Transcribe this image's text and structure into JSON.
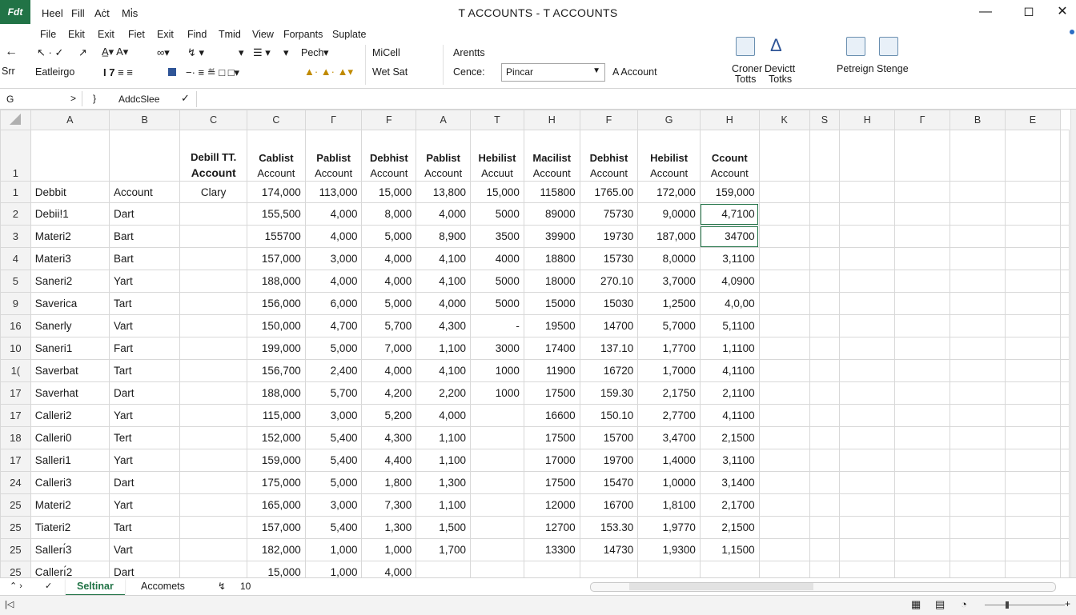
{
  "app": {
    "title": "T ACCOUNTS - T ACCOUNTS",
    "logo": "Fdt",
    "quick_access": [
      "Heel",
      "Fill",
      "Aċt",
      "Mi̇s"
    ]
  },
  "menu": [
    "File",
    "Ekit",
    "Exit",
    "Fiet",
    "Exit",
    "Find",
    "Tmid",
    "View",
    "Forpants",
    "Suplate"
  ],
  "ribbon": {
    "back_label": "Srr",
    "font_label": "Eatleirgo",
    "pech": "Pech",
    "micell": "MiCell",
    "wet_set": "Wet Sat",
    "arents": "Arentts",
    "cence": "Cence:",
    "cence_value": "Pincar",
    "account": "A Account",
    "croner_line1": "Croner",
    "croner_line2": "Totts",
    "devict_line1": "Devictt",
    "devict_line2": "Totks",
    "petreign": "Petreign Stenge"
  },
  "formula_bar": {
    "name_box": "G",
    "fx_text": "AddcSlee",
    "arrow": ">",
    "brace": "}"
  },
  "colors": {
    "accent": "#217346",
    "header_bg": "#f3f3f3",
    "grid": "#d8d8d8"
  },
  "icons": [
    "undo-icon",
    "back-icon",
    "bold-icon",
    "fill-color-icon",
    "font-color-icon",
    "copy-icon",
    "shapes-icon",
    "text-icon",
    "accounts-icon"
  ],
  "grid": {
    "col_headers": [
      "A",
      "B",
      "C",
      "C",
      "Γ",
      "F",
      "A",
      "T",
      "H",
      "F",
      "G",
      "H",
      "K",
      "S",
      "H",
      "Γ",
      "B",
      "E"
    ],
    "header_row_num": "1",
    "header_top": [
      "",
      "",
      "Debill TT.",
      "Cablist",
      "Pablist",
      "Debhist",
      "Pablist",
      "Hebilist",
      "Macilist",
      "Debhist",
      "Hebilist",
      "Ccount"
    ],
    "header_bottom": [
      "",
      "",
      "Account",
      "Account",
      "Account",
      "Account",
      "Account",
      "Accuut",
      "Account",
      "Account",
      "Account",
      "Account"
    ],
    "rows": [
      {
        "n": "1",
        "cells": [
          "Debbit",
          "Account",
          "Clary",
          "174,000",
          "113,000",
          "15,000",
          "13,800",
          "15,000",
          "115800",
          "1765.00",
          "172,000",
          "159,000"
        ]
      },
      {
        "n": "2",
        "cells": [
          "Debii!1",
          "Dart",
          "",
          "155,500",
          "4,000",
          "8,000",
          "4,000",
          "5000",
          "89000",
          "75730",
          "9,0000",
          "4,7100"
        ]
      },
      {
        "n": "3",
        "cells": [
          "Materi2",
          "Bart",
          "",
          "155700",
          "4,000",
          "5,000",
          "8,900",
          "3500",
          "39900",
          "19730",
          "187,000",
          "34700"
        ]
      },
      {
        "n": "4",
        "cells": [
          "Materi3",
          "Bart",
          "",
          "157,000",
          "3,000",
          "4,000",
          "4,100",
          "4000",
          "18800",
          "15730",
          "8,0000",
          "3,1100"
        ]
      },
      {
        "n": "5",
        "cells": [
          "Saneri2",
          "Yart",
          "",
          "188,000",
          "4,000",
          "4,000",
          "4,100",
          "5000",
          "18000",
          "270.10",
          "3,7000",
          "4,0900"
        ]
      },
      {
        "n": "9",
        "cells": [
          "Saverica",
          "Tart",
          "",
          "156,000",
          "6,000",
          "5,000",
          "4,000",
          "5000",
          "15000",
          "15030",
          "1,2500",
          "4,0,00"
        ]
      },
      {
        "n": "16",
        "cells": [
          "Sanerly",
          "Vart",
          "",
          "150,000",
          "4,700",
          "5,700",
          "4,300",
          "-",
          "19500",
          "14700",
          "5,7000",
          "5,1100"
        ]
      },
      {
        "n": "10",
        "cells": [
          "Saneri1",
          "Fart",
          "",
          "199,000",
          "5,000",
          "7,000",
          "1,100",
          "3000",
          "17400",
          "137.10",
          "1,7700",
          "1,1100"
        ]
      },
      {
        "n": "1(",
        "cells": [
          "Saverbat",
          "Tart",
          "",
          "156,700",
          "2,400",
          "4,000",
          "4,100",
          "1000",
          "11900",
          "16720",
          "1,7000",
          "4,1100"
        ]
      },
      {
        "n": "17",
        "cells": [
          "Saverhat",
          "Dart",
          "",
          "188,000",
          "5,700",
          "4,200",
          "2,200",
          "1000",
          "17500",
          "159.30",
          "2,1750",
          "2,1100"
        ]
      },
      {
        "n": "17",
        "cells": [
          "Calleri2",
          "Yart",
          "",
          "115,000",
          "3,000",
          "5,200",
          "4,000",
          "",
          "16600",
          "150.10",
          "2,7700",
          "4,1100"
        ]
      },
      {
        "n": "18",
        "cells": [
          "Calleri0",
          "Tert",
          "",
          "152,000",
          "5,400",
          "4,300",
          "1,100",
          "",
          "17500",
          "15700",
          "3,4700",
          "2,1500"
        ]
      },
      {
        "n": "17",
        "cells": [
          "Salleri1",
          "Yart",
          "",
          "159,000",
          "5,400",
          "4,400",
          "1,100",
          "",
          "17000",
          "19700",
          "1,4000",
          "3,1100"
        ]
      },
      {
        "n": "24",
        "cells": [
          "Calleri3",
          "Dart",
          "",
          "175,000",
          "5,000",
          "1,800",
          "1,300",
          "",
          "17500",
          "15470",
          "1,0000",
          "3,1400"
        ]
      },
      {
        "n": "25",
        "cells": [
          "Materi2",
          "Yart",
          "",
          "165,000",
          "3,000",
          "7,300",
          "1,100",
          "",
          "12000",
          "16700",
          "1,8100",
          "2,1700"
        ]
      },
      {
        "n": "25",
        "cells": [
          "Tiateri2",
          "Tart",
          "",
          "157,000",
          "5,400",
          "1,300",
          "1,500",
          "",
          "12700",
          "153.30",
          "1,9770",
          "2,1500"
        ]
      },
      {
        "n": "25",
        "cells": [
          "Sallerı́3",
          "Vart",
          "",
          "182,000",
          "1,000",
          "1,000",
          "1,700",
          "",
          "13300",
          "14730",
          "1,9300",
          "1,1500"
        ]
      },
      {
        "n": "25",
        "cells": [
          "Callerı́2",
          "Dart",
          "",
          "15,000",
          "1,000",
          "4,000",
          "",
          "",
          "",
          "",
          "",
          ""
        ]
      }
    ]
  },
  "tabs": {
    "active": "Seltinar",
    "other": "Accomets",
    "extra": "10"
  },
  "status": {
    "left": "|◁"
  }
}
